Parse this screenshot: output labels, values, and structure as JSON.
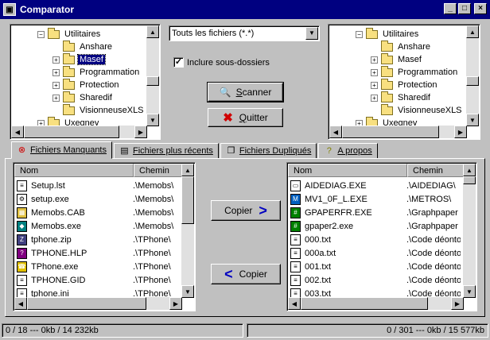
{
  "window": {
    "title": "Comparator",
    "minimize": "_",
    "maximize": "□",
    "close": "×"
  },
  "left_tree": [
    {
      "label": "Utilitaires",
      "expander": "−",
      "indent": 0
    },
    {
      "label": "Anshare",
      "expander": "",
      "indent": 1
    },
    {
      "label": "Masef",
      "expander": "+",
      "indent": 1,
      "selected": true,
      "open": true
    },
    {
      "label": "Programmation",
      "expander": "+",
      "indent": 1
    },
    {
      "label": "Protection",
      "expander": "+",
      "indent": 1
    },
    {
      "label": "Sharedif",
      "expander": "+",
      "indent": 1
    },
    {
      "label": "VisionneuseXLS",
      "expander": "",
      "indent": 1
    },
    {
      "label": "Uxegney",
      "expander": "+",
      "indent": 0
    }
  ],
  "right_tree": [
    {
      "label": "Utilitaires",
      "expander": "−",
      "indent": 0
    },
    {
      "label": "Anshare",
      "expander": "",
      "indent": 1
    },
    {
      "label": "Masef",
      "expander": "+",
      "indent": 1,
      "open": true
    },
    {
      "label": "Programmation",
      "expander": "+",
      "indent": 1
    },
    {
      "label": "Protection",
      "expander": "+",
      "indent": 1
    },
    {
      "label": "Sharedif",
      "expander": "+",
      "indent": 1
    },
    {
      "label": "VisionneuseXLS",
      "expander": "",
      "indent": 1
    },
    {
      "label": "Uxegney",
      "expander": "+",
      "indent": 0
    }
  ],
  "filter": {
    "value": "Touts les fichiers (*.*)"
  },
  "include_subfolders": {
    "label": "Inclure sous-dossiers",
    "checked": true
  },
  "buttons": {
    "scan": "Scanner",
    "scan_key": "S",
    "quit": "Quitter",
    "quit_key": "Q",
    "copy_right": "Copier",
    "copy_left": "Copier"
  },
  "tabs": [
    {
      "label": "Fichiers Manquants",
      "key": "F",
      "icon": "missing-files-icon",
      "active": true
    },
    {
      "label": "Fichiers plus récents",
      "key": "F",
      "icon": "newer-files-icon"
    },
    {
      "label": "Fichiers Dupliqués",
      "key": "F",
      "icon": "duplicate-files-icon"
    },
    {
      "label": "A propos",
      "key": "A",
      "icon": "about-icon"
    }
  ],
  "columns": {
    "name": "Nom",
    "path": "Chemin"
  },
  "left_files": [
    {
      "name": "Setup.lst",
      "path": ".\\Memobs\\",
      "icon": "text-file-icon"
    },
    {
      "name": "setup.exe",
      "path": ".\\Memobs\\",
      "icon": "setup-exe-icon"
    },
    {
      "name": "Memobs.CAB",
      "path": ".\\Memobs\\",
      "icon": "cabinet-file-icon"
    },
    {
      "name": "Memobs.exe",
      "path": ".\\Memobs\\",
      "icon": "app-exe-icon"
    },
    {
      "name": "tphone.zip",
      "path": ".\\TPhone\\",
      "icon": "zip-file-icon"
    },
    {
      "name": "TPHONE.HLP",
      "path": ".\\TPhone\\",
      "icon": "help-file-icon"
    },
    {
      "name": "TPhone.exe",
      "path": ".\\TPhone\\",
      "icon": "phone-exe-icon"
    },
    {
      "name": "TPHONE.GID",
      "path": ".\\TPhone\\",
      "icon": "gid-file-icon"
    },
    {
      "name": "tphone.ini",
      "path": ".\\TPhone\\",
      "icon": "ini-file-icon"
    }
  ],
  "right_files": [
    {
      "name": "AIDEDIAG.EXE",
      "path": ".\\AIDEDIAG\\",
      "icon": "window-exe-icon"
    },
    {
      "name": "MV1_0F_L.EXE",
      "path": ".\\METROS\\",
      "icon": "metro-exe-icon"
    },
    {
      "name": "GPAPERFR.EXE",
      "path": ".\\Graphpaper",
      "icon": "graph-exe-icon"
    },
    {
      "name": "gpaper2.exe",
      "path": ".\\Graphpaper",
      "icon": "graph-exe-icon"
    },
    {
      "name": "000.txt",
      "path": ".\\Code déonto",
      "icon": "text-file-icon"
    },
    {
      "name": "000a.txt",
      "path": ".\\Code déonto",
      "icon": "text-file-icon"
    },
    {
      "name": "001.txt",
      "path": ".\\Code déonto",
      "icon": "text-file-icon"
    },
    {
      "name": "002.txt",
      "path": ".\\Code déonto",
      "icon": "text-file-icon"
    },
    {
      "name": "003.txt",
      "path": ".\\Code déonto",
      "icon": "text-file-icon"
    }
  ],
  "status": {
    "left": "0 / 18 --- 0kb / 14 232kb",
    "right": "0 / 301 --- 0kb / 15 577kb"
  },
  "colors": {
    "titlebar": "#000080",
    "face": "#c0c0c0",
    "selection": "#000080",
    "arrow": "#0000c0",
    "quit_x": "#d00000"
  }
}
